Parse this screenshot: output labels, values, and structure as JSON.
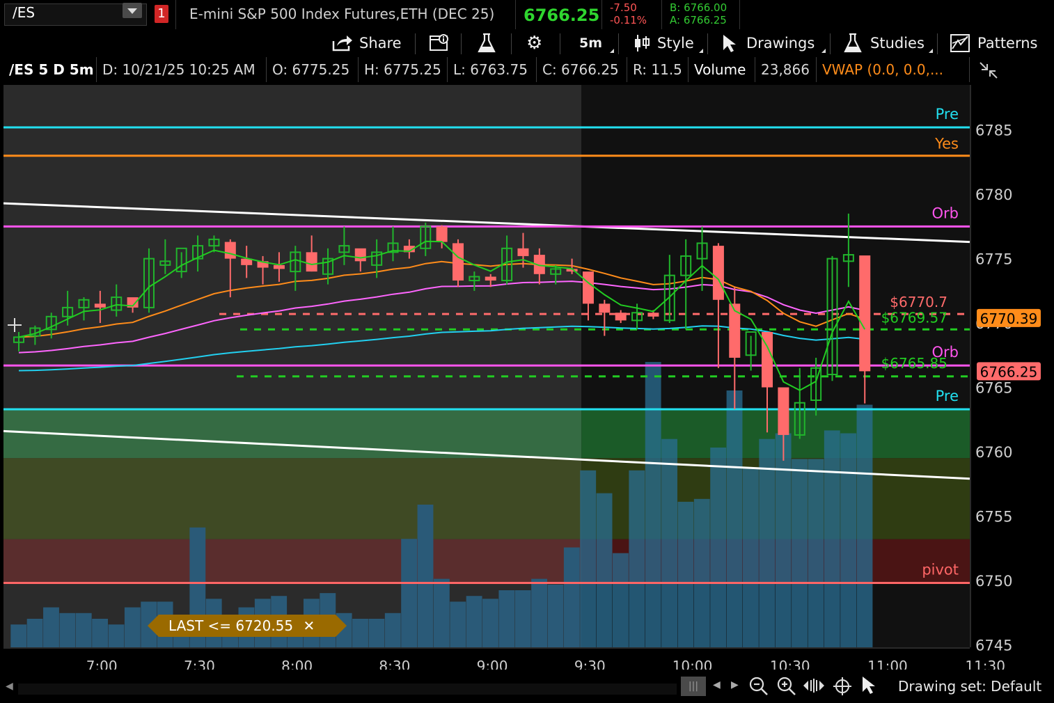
{
  "header": {
    "symbol": "/ES",
    "link_badge": "1",
    "instrument": "E-mini S&P 500 Index Futures,ETH (DEC 25)",
    "last": "6766.25",
    "change": "-7.50",
    "change_pct": "-0.11%",
    "bid": "B: 6766.00",
    "ask": "A: 6766.25"
  },
  "toolbar": {
    "share": "Share",
    "timeframe": "5m",
    "style": "Style",
    "drawings": "Drawings",
    "studies": "Studies",
    "patterns": "Patterns"
  },
  "info": {
    "title": "/ES 5 D 5m",
    "date": "D: 10/21/25 10:25 AM",
    "open": "O: 6775.25",
    "high": "H: 6775.25",
    "low": "L: 6763.75",
    "close": "C: 6766.25",
    "range": "R: 11.5",
    "volume_label": "Volume",
    "volume_value": "23,866",
    "vwap": "VWAP (0.0, 0.0,..."
  },
  "chart_data": {
    "type": "candlestick",
    "x_labels": [
      "7:00",
      "7:30",
      "8:00",
      "8:30",
      "9:00",
      "9:30",
      "10:00",
      "10:30",
      "11:00",
      "11:30"
    ],
    "y_ticks": [
      6785,
      6780,
      6775,
      6770,
      6765,
      6760,
      6755,
      6750,
      6745
    ],
    "ylim": [
      6744.8,
      6788.5
    ],
    "levels": [
      {
        "label": "Pre",
        "value": 6785.2,
        "color": "#22e0f0"
      },
      {
        "label": "Yes",
        "value": 6783.0,
        "color": "#ff8c1a"
      },
      {
        "label": "Orb",
        "value": 6777.5,
        "color": "#ff55ee"
      },
      {
        "label": "Orb",
        "value": 6766.7,
        "color": "#ff55ee"
      },
      {
        "label": "Pre",
        "value": 6763.3,
        "color": "#22e0f0"
      },
      {
        "label": "pivot",
        "value": 6749.8,
        "color": "#ff6666"
      }
    ],
    "dashed_levels": [
      {
        "label": "$6770.7",
        "value": 6770.7,
        "color": "#ff6b6b"
      },
      {
        "label": "$6769.57",
        "value": 6769.5,
        "color": "#22cc22"
      },
      {
        "label": "$6765.85",
        "value": 6765.85,
        "color": "#22cc22"
      }
    ],
    "price_tags": [
      {
        "text": "6770.39",
        "value": 6770.39,
        "bg": "#ff8c1a",
        "fg": "#000"
      },
      {
        "text": "6766.25",
        "value": 6766.25,
        "bg": "#ff6b6b",
        "fg": "#000"
      }
    ],
    "candles": [
      [
        6768.5,
        6769.3,
        6767.8,
        6768.9
      ],
      [
        6769.0,
        6769.8,
        6768.3,
        6769.6
      ],
      [
        6769.5,
        6770.8,
        6768.8,
        6770.5
      ],
      [
        6770.5,
        6772.5,
        6769.8,
        6771.2
      ],
      [
        6771.2,
        6772.0,
        6770.2,
        6771.8
      ],
      [
        6771.5,
        6772.5,
        6770.0,
        6771.2
      ],
      [
        6771.0,
        6773.0,
        6770.5,
        6772.0
      ],
      [
        6772.0,
        6771.5,
        6770.8,
        6771.2
      ],
      [
        6771.2,
        6775.8,
        6770.8,
        6775.0
      ],
      [
        6774.5,
        6776.5,
        6773.8,
        6774.8
      ],
      [
        6774.0,
        6775.5,
        6773.5,
        6775.8
      ],
      [
        6775.0,
        6776.8,
        6774.0,
        6776.0
      ],
      [
        6776.0,
        6776.8,
        6775.5,
        6776.5
      ],
      [
        6776.3,
        6776.5,
        6772.0,
        6775.0
      ],
      [
        6775.0,
        6776.0,
        6773.5,
        6774.5
      ],
      [
        6774.8,
        6775.2,
        6773.0,
        6774.3
      ],
      [
        6774.5,
        6775.5,
        6773.2,
        6774.2
      ],
      [
        6774.0,
        6776.0,
        6772.5,
        6775.5
      ],
      [
        6775.5,
        6776.8,
        6774.0,
        6774.0
      ],
      [
        6773.8,
        6775.8,
        6773.0,
        6775.0
      ],
      [
        6775.5,
        6777.5,
        6774.5,
        6776.0
      ],
      [
        6775.8,
        6775.0,
        6774.0,
        6774.8
      ],
      [
        6774.5,
        6776.5,
        6773.5,
        6775.5
      ],
      [
        6775.5,
        6777.5,
        6774.8,
        6776.2
      ],
      [
        6776.0,
        6776.5,
        6775.0,
        6775.5
      ],
      [
        6775.8,
        6777.8,
        6775.2,
        6777.5
      ],
      [
        6777.5,
        6777.6,
        6775.8,
        6776.3
      ],
      [
        6776.2,
        6776.5,
        6772.8,
        6773.3
      ],
      [
        6773.3,
        6774.0,
        6772.5,
        6773.6
      ],
      [
        6773.6,
        6773.8,
        6772.8,
        6773.3
      ],
      [
        6773.3,
        6776.8,
        6773.0,
        6775.8
      ],
      [
        6775.8,
        6777.0,
        6774.3,
        6775.2
      ],
      [
        6775.3,
        6775.8,
        6773.0,
        6773.8
      ],
      [
        6773.8,
        6774.5,
        6773.0,
        6774.2
      ],
      [
        6774.2,
        6775.0,
        6773.8,
        6774.0
      ],
      [
        6774.0,
        6773.8,
        6770.2,
        6771.5
      ],
      [
        6771.5,
        6771.8,
        6769.0,
        6770.8
      ],
      [
        6770.8,
        6771.0,
        6770.0,
        6770.2
      ],
      [
        6770.2,
        6771.5,
        6769.5,
        6770.8
      ],
      [
        6770.8,
        6771.0,
        6770.3,
        6770.5
      ],
      [
        6770.2,
        6775.3,
        6770.0,
        6773.7
      ],
      [
        6773.7,
        6776.5,
        6769.5,
        6775.2
      ],
      [
        6775.0,
        6777.5,
        6772.5,
        6776.2
      ],
      [
        6776.0,
        6776.2,
        6766.5,
        6771.8
      ],
      [
        6771.5,
        6772.8,
        6763.3,
        6767.3
      ],
      [
        6767.5,
        6769.0,
        6766.3,
        6769.3
      ],
      [
        6769.3,
        6769.0,
        6761.5,
        6765.0
      ],
      [
        6765.0,
        6765.0,
        6759.3,
        6761.3
      ],
      [
        6761.3,
        6766.5,
        6761.0,
        6763.8
      ],
      [
        6764.0,
        6767.3,
        6762.8,
        6766.5
      ],
      [
        6766.0,
        6775.2,
        6765.5,
        6775.0
      ],
      [
        6774.8,
        6778.5,
        6772.8,
        6775.3
      ],
      [
        6775.25,
        6775.25,
        6763.75,
        6766.25
      ]
    ],
    "volume_rel": [
      0.08,
      0.1,
      0.14,
      0.12,
      0.12,
      0.1,
      0.08,
      0.14,
      0.16,
      0.16,
      0.09,
      0.42,
      0.17,
      0.1,
      0.14,
      0.17,
      0.18,
      0.1,
      0.17,
      0.19,
      0.12,
      0.1,
      0.1,
      0.12,
      0.38,
      0.5,
      0.24,
      0.16,
      0.18,
      0.17,
      0.2,
      0.2,
      0.24,
      0.22,
      0.35,
      0.62,
      0.54,
      0.33,
      0.62,
      1.0,
      0.73,
      0.51,
      0.52,
      0.7,
      0.9,
      0.63,
      0.73,
      0.75,
      0.66,
      0.66,
      0.76,
      0.75,
      0.85
    ],
    "sessions": {
      "premarket_end_index": 34
    }
  },
  "alert": {
    "text": "LAST <= 6720.55",
    "close": "✕"
  },
  "bottom": {
    "drawing_set": "Drawing set: Default"
  },
  "colors": {
    "up": "#21b52c",
    "down": "#ff6b6b",
    "volume": "#2a6d93",
    "ema_green": "#22cc22",
    "vwap_orange": "#ff8c1a",
    "ma_pink": "#ff66ff",
    "ma_cyan": "#22d0f0"
  }
}
